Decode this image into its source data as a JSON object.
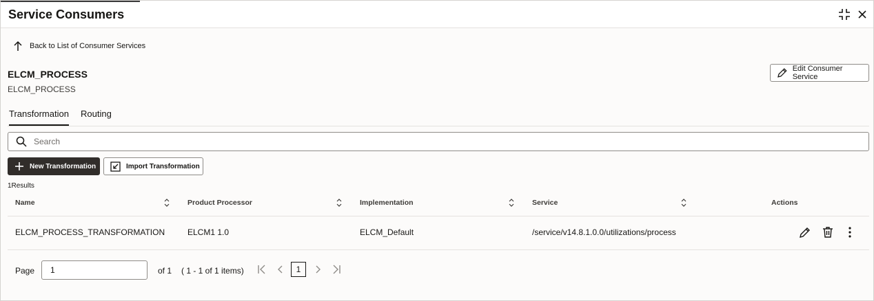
{
  "header": {
    "title": "Service Consumers",
    "icons": [
      "fullscreen-collapse-icon",
      "close-icon"
    ]
  },
  "back_link": {
    "label": "Back to List of Consumer Services",
    "icon": "arrow-up-icon"
  },
  "entity": {
    "title": "ELCM_PROCESS",
    "subtitle": "ELCM_PROCESS",
    "edit_button": "Edit Consumer Service"
  },
  "tabs": [
    {
      "label": "Transformation",
      "active": true
    },
    {
      "label": "Routing",
      "active": false
    }
  ],
  "search": {
    "placeholder": "Search",
    "value": ""
  },
  "toolbar": {
    "new_button": "New Transformation",
    "import_button": "Import Transformation"
  },
  "results_text": "1Results",
  "table": {
    "columns": [
      "Name",
      "Product Processor",
      "Implementation",
      "Service",
      "Actions"
    ],
    "rows": [
      {
        "name": "ELCM_PROCESS_TRANSFORMATION",
        "product_processor": "ELCM1 1.0",
        "implementation": "ELCM_Default",
        "service": "/service/v14.8.1.0.0/utilizations/process",
        "actions": [
          "edit-icon",
          "delete-icon",
          "more-vertical-icon"
        ]
      }
    ]
  },
  "pagination": {
    "page_label": "Page",
    "page_value": "1",
    "of_label": "of 1",
    "items_label": "( 1 - 1 of 1 items)",
    "current_page": "1"
  },
  "colors": {
    "dark_button": "#312d2a",
    "border": "#8e8b87",
    "text": "#161513"
  }
}
